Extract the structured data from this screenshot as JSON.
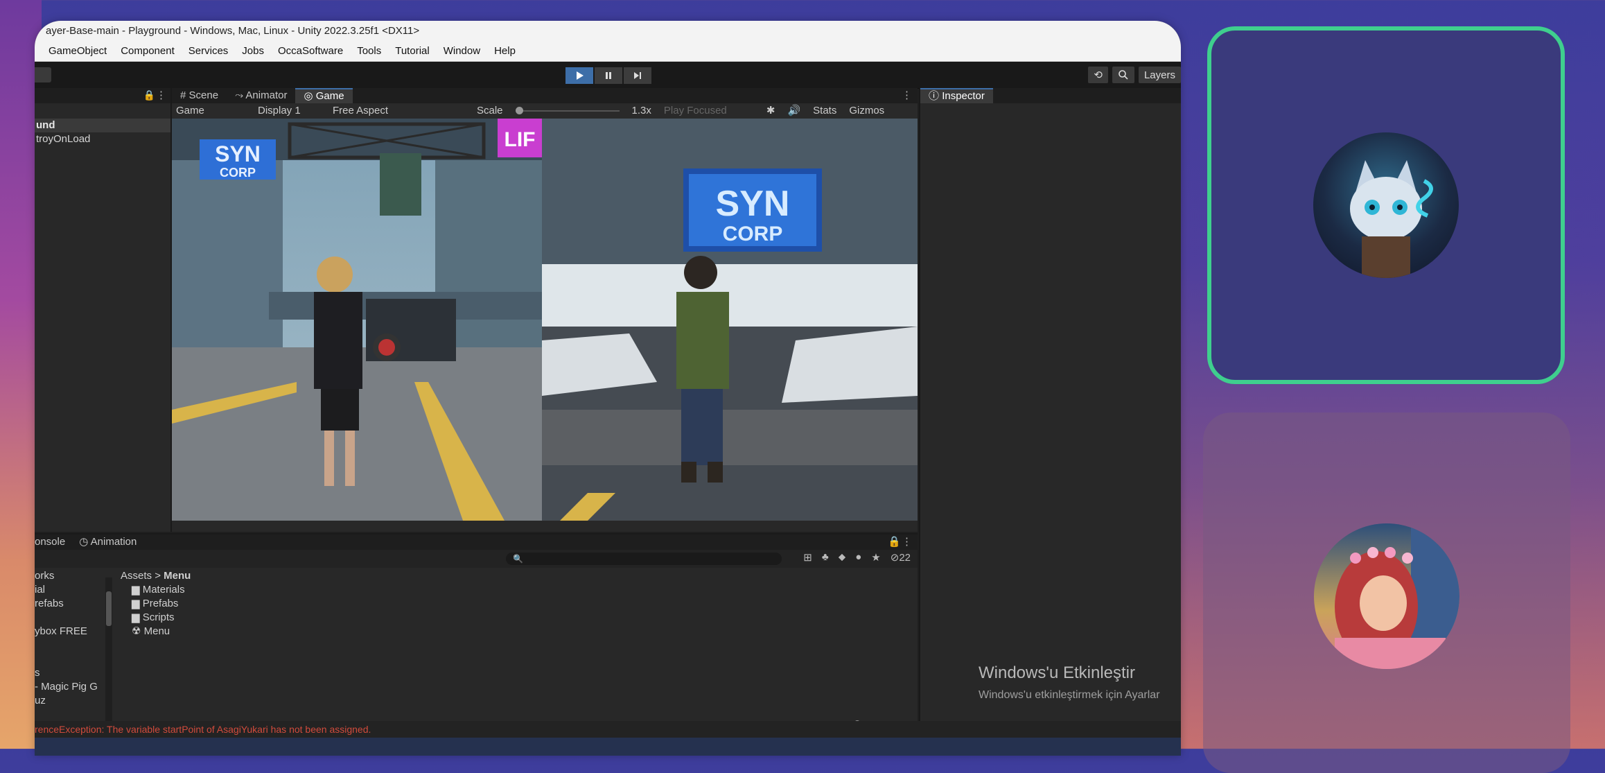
{
  "window": {
    "title": "ayer-Base-main - Playground - Windows, Mac, Linux - Unity 2022.3.25f1 <DX11>",
    "menu": [
      "GameObject",
      "Component",
      "Services",
      "Jobs",
      "OccaSoftware",
      "Tools",
      "Tutorial",
      "Window",
      "Help"
    ]
  },
  "toolbar": {
    "layers_label": "Layers",
    "play_icon": "play-icon",
    "pause_icon": "pause-icon",
    "step_icon": "step-icon"
  },
  "hierarchy": {
    "rows": [
      "und",
      "troyOnLoad"
    ]
  },
  "game_panel": {
    "tabs": [
      "Scene",
      "Animator",
      "Game"
    ],
    "active_tab": "Game",
    "display_select": "Game",
    "display": "Display 1",
    "aspect": "Free Aspect",
    "scale_label": "Scale",
    "scale_value": "1.3x",
    "play_focused": "Play Focused",
    "stats": "Stats",
    "gizmos": "Gizmos",
    "sign_left_line1": "SYN",
    "sign_left_line2": "CORP",
    "sign_right_line1": "SYN",
    "sign_right_line2": "CORP",
    "sign_lif": "LIF"
  },
  "inspector": {
    "tab": "Inspector"
  },
  "bottom_panel": {
    "tabs": [
      "onsole",
      "Animation"
    ],
    "hidden_count": "22",
    "breadcrumb_root": "Assets",
    "breadcrumb_sep": ">",
    "breadcrumb_current": "Menu",
    "left_items": [
      "orks",
      "ial",
      "refabs",
      "",
      "ybox FREE",
      "",
      "",
      "s",
      "- Magic Pig G",
      "uz"
    ],
    "folders": [
      "Materials",
      "Prefabs",
      "Scripts"
    ],
    "scene_item": "Menu"
  },
  "status_error": "renceException: The variable startPoint of AsagiYukari has not been assigned.",
  "windows_activation": {
    "title": "Windows'u Etkinleştir",
    "subtitle": "Windows'u etkinleştirmek için Ayarlar"
  },
  "colors": {
    "accent": "#3d6ea8",
    "card_border": "#3fcf8e",
    "error": "#d14b3c"
  }
}
